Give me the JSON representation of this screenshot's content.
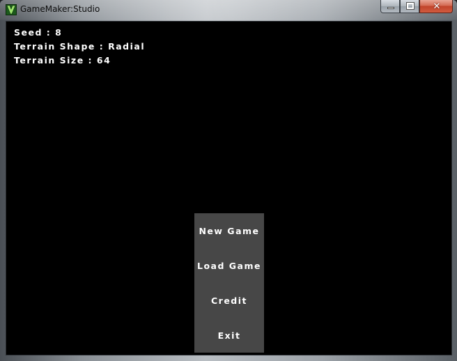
{
  "window": {
    "title": "GameMaker:Studio",
    "icon": "gamemaker-logo-icon",
    "close_glyph": "✕"
  },
  "hud": {
    "lines": [
      "Seed : 8",
      "Terrain Shape : Radial",
      "Terrain Size : 64"
    ]
  },
  "menu": {
    "items": [
      "New Game",
      "Load Game",
      "Credit",
      "Exit"
    ]
  },
  "colors": {
    "viewport_bg": "#000000",
    "menu_bg": "#474747",
    "text": "#ffffff"
  }
}
